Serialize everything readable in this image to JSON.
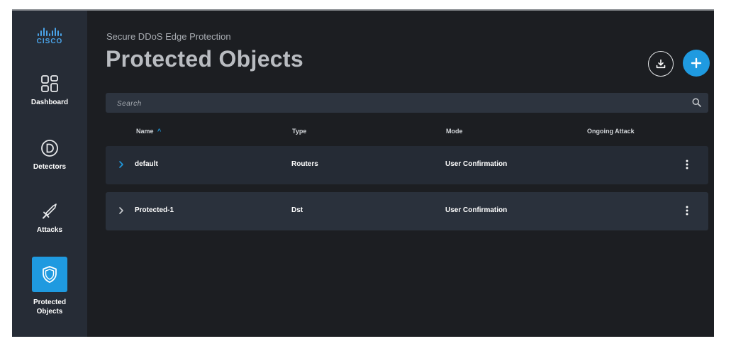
{
  "brand": {
    "logo_text": "CISCO"
  },
  "sidebar": {
    "items": [
      {
        "label": "Dashboard",
        "icon": "dashboard-icon"
      },
      {
        "label": "Detectors",
        "icon": "detector-icon"
      },
      {
        "label": "Attacks",
        "icon": "sword-icon"
      },
      {
        "label": "Protected Objects",
        "icon": "shield-icon",
        "active": true
      }
    ]
  },
  "header": {
    "subtitle": "Secure DDoS Edge Protection",
    "title": "Protected Objects"
  },
  "search": {
    "placeholder": "Search",
    "value": ""
  },
  "table": {
    "columns": [
      "Name",
      "Type",
      "Mode",
      "Ongoing Attack"
    ],
    "sort_indicator": "^",
    "rows": [
      {
        "name": "default",
        "type": "Routers",
        "mode": "User Confirmation",
        "ongoing_attack": ""
      },
      {
        "name": "Protected-1",
        "type": "Dst",
        "mode": "User Confirmation",
        "ongoing_attack": ""
      }
    ]
  },
  "colors": {
    "accent": "#1f9ae0",
    "background": "#1c1e22",
    "sidebar": "#262c36",
    "row": "#2a313c"
  }
}
